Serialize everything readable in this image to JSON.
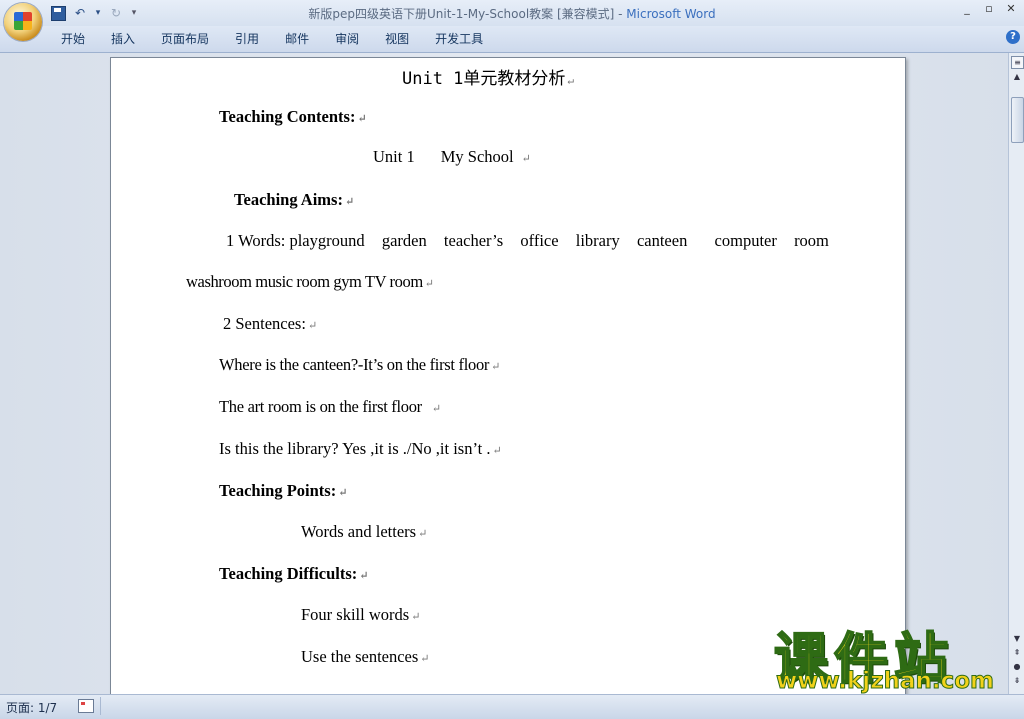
{
  "window": {
    "title": "新版pep四级英语下册Unit-1-My-School教案 [兼容模式] - ",
    "app_name": "Microsoft Word",
    "controls": [
      "_",
      "▫",
      "✕"
    ]
  },
  "quick_access": {
    "undo_dropdown": "▾",
    "redo": "↻",
    "customize": "▾"
  },
  "ribbon": {
    "tabs": [
      "开始",
      "插入",
      "页面布局",
      "引用",
      "邮件",
      "审阅",
      "视图",
      "开发工具"
    ],
    "help": "?"
  },
  "document": {
    "title": "Unit 1单元教材分析",
    "para_mark": "↵",
    "lines": {
      "teaching_contents": "Teaching Contents:",
      "unit_label": "Unit 1",
      "unit_name": "My School",
      "teaching_aims": "Teaching Aims:",
      "words_line1": [
        "1 Words: playground",
        "garden",
        "teacher’s",
        "office",
        "library",
        "canteen",
        "computer",
        "room"
      ],
      "words_line2": "washroom music room gym TV room",
      "sentences_label": "2 Sentences:",
      "sentence1": "Where is the canteen?-It’s on the first floor",
      "sentence2": "The art room is on the first floor",
      "sentence3": "Is this the library? Yes ,it is ./No ,it isn’t .",
      "teaching_points": "Teaching Points:",
      "points_item": "Words and letters",
      "teaching_difficults": "Teaching Difficults:",
      "difficult_item1": "Four skill words",
      "difficult_item2": "Use the sentences"
    }
  },
  "statusbar": {
    "page_indicator": "页面: 1/7"
  },
  "watermark": {
    "text": "课件站",
    "url": "www.kjzhan.com"
  },
  "colors": {
    "accent": "#3a6fbe",
    "ribbon_bg": "#cdd9ec",
    "workspace": "#d7dfea",
    "watermark_fill": "#e8d11a",
    "watermark_stroke": "#2e6b14"
  }
}
